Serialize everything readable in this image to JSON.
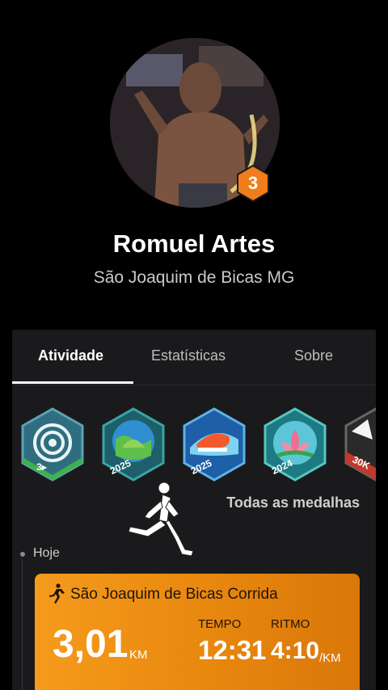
{
  "profile": {
    "name": "Romuel Artes",
    "location": "São Joaquim de Bicas MG",
    "level": "3"
  },
  "tabs": [
    {
      "label": "Atividade",
      "active": true
    },
    {
      "label": "Estatísticas",
      "active": false
    },
    {
      "label": "Sobre",
      "active": false
    }
  ],
  "medals": [
    {
      "icon": "target-medal-icon",
      "label": "3▸",
      "color": "#3a8d9a"
    },
    {
      "icon": "earth-2025-medal-icon",
      "label": "2025",
      "color": "#1f7f6a"
    },
    {
      "icon": "sneaker-2025-medal-icon",
      "label": "2025",
      "color": "#1f6fb0"
    },
    {
      "icon": "lotus-2024-medal-icon",
      "label": "2024",
      "color": "#2a9c8a"
    },
    {
      "icon": "30k-medal-icon",
      "label": "30K",
      "color": "#c0392b"
    }
  ],
  "all_medals_label": "Todas as medalhas",
  "timeline": {
    "today_label": "Hoje"
  },
  "activity": {
    "title": "São Joaquim de Bicas Corrida",
    "distance": "3,01",
    "distance_unit": "KM",
    "time_label": "TEMPO",
    "time": "12:31",
    "pace_label": "RITMO",
    "pace": "4:10",
    "pace_unit": "/KM",
    "accent": "#f59b1c"
  }
}
